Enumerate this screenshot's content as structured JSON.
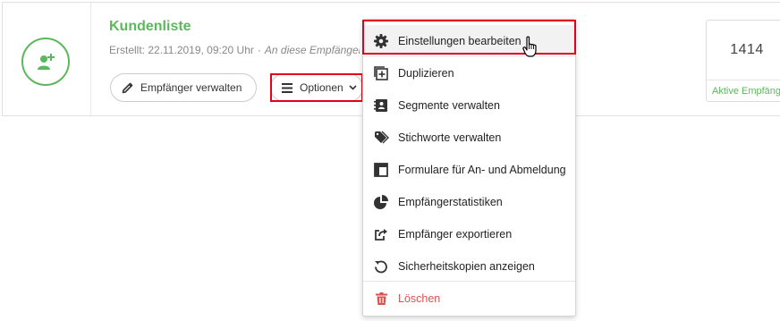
{
  "list": {
    "title": "Kundenliste",
    "created": "Erstellt: 22.11.2019, 09:20 Uhr",
    "separator": "·",
    "note": "An diese Empfängerliste"
  },
  "buttons": {
    "manage_label": "Empfänger verwalten",
    "options_label": "Optionen"
  },
  "stats": {
    "value": "1414",
    "label": "Aktive Empfänger"
  },
  "menu": {
    "items": [
      {
        "label": "Einstellungen bearbeiten",
        "icon": "gear-icon"
      },
      {
        "label": "Duplizieren",
        "icon": "duplicate-icon"
      },
      {
        "label": "Segmente verwalten",
        "icon": "segments-icon"
      },
      {
        "label": "Stichworte verwalten",
        "icon": "tags-icon"
      },
      {
        "label": "Formulare für An- und Abmeldung",
        "icon": "form-icon"
      },
      {
        "label": "Empfängerstatistiken",
        "icon": "pie-chart-icon"
      },
      {
        "label": "Empfänger exportieren",
        "icon": "export-icon"
      },
      {
        "label": "Sicherheitskopien anzeigen",
        "icon": "history-icon"
      },
      {
        "label": "Löschen",
        "icon": "trash-icon"
      }
    ]
  },
  "colors": {
    "accent_green": "#5cb85c",
    "highlight_red": "#e2001a",
    "danger": "#d9534f"
  }
}
